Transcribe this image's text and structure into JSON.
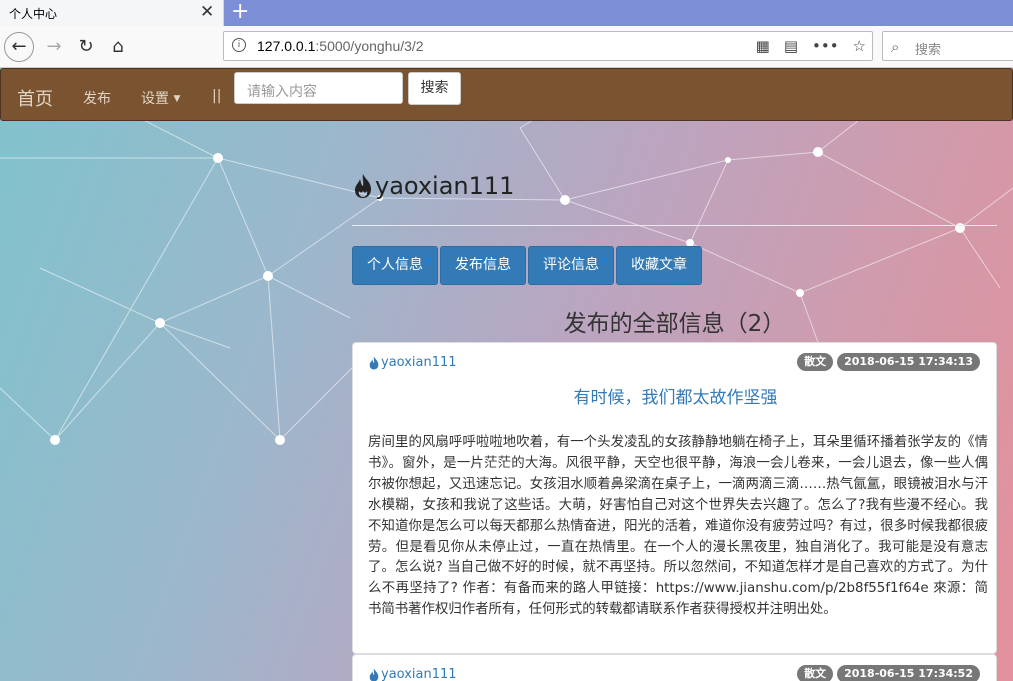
{
  "browser": {
    "tab_title": "个人中心",
    "tab_close": "✕",
    "new_tab": "+",
    "url_host": "127.0.0.1",
    "url_path": ":5000/yonghu/3/2",
    "search_placeholder": "搜索"
  },
  "nav": {
    "brand": "首页",
    "publish": "发布",
    "settings": "设置",
    "separator": "||",
    "search_placeholder": "请输入内容",
    "search_button": "搜索"
  },
  "profile": {
    "username": "yaoxian111",
    "buttons": [
      "个人信息",
      "发布信息",
      "评论信息",
      "收藏文章"
    ]
  },
  "section_title": "发布的全部信息（2）",
  "posts": [
    {
      "author": "yaoxian111",
      "category": "散文",
      "datetime": "2018-06-15 17:34:13",
      "title": "有时候，我们都太故作坚强",
      "body": "房间里的风扇呼呼啦啦地吹着，有一个头发凌乱的女孩静静地躺在椅子上，耳朵里循环播着张学友的《情书》。窗外，是一片茫茫的大海。风很平静，天空也很平静，海浪一会儿卷来，一会儿退去，像一些人偶尔被你想起，又迅速忘记。女孩泪水顺着鼻梁滴在桌子上，一滴两滴三滴……热气氤氲，眼镜被泪水与汗水模糊，女孩和我说了这些话。大萌，好害怕自己对这个世界失去兴趣了。怎么了?我有些漫不经心。我不知道你是怎么可以每天都那么热情奋进，阳光的活着，难道你没有疲劳过吗？有过，很多时候我都很疲劳。但是看见你从未停止过，一直在热情里。在一个人的漫长黑夜里，独自消化了。我可能是没有意志了。怎么说? 当自己做不好的时候，就不再坚持。所以忽然间，不知道怎样才是自己喜欢的方式了。为什么不再坚持了? 作者：有备而来的路人甲链接：https://www.jianshu.com/p/2b8f55f1f64e 來源：简书简书著作权归作者所有，任何形式的转载都请联系作者获得授权并注明出处。"
    },
    {
      "author": "yaoxian111",
      "category": "散文",
      "datetime": "2018-06-15 17:34:52"
    }
  ],
  "colors": {
    "nav_bg": "#7a5330",
    "primary": "#337ab7",
    "label_bg": "#777777"
  }
}
